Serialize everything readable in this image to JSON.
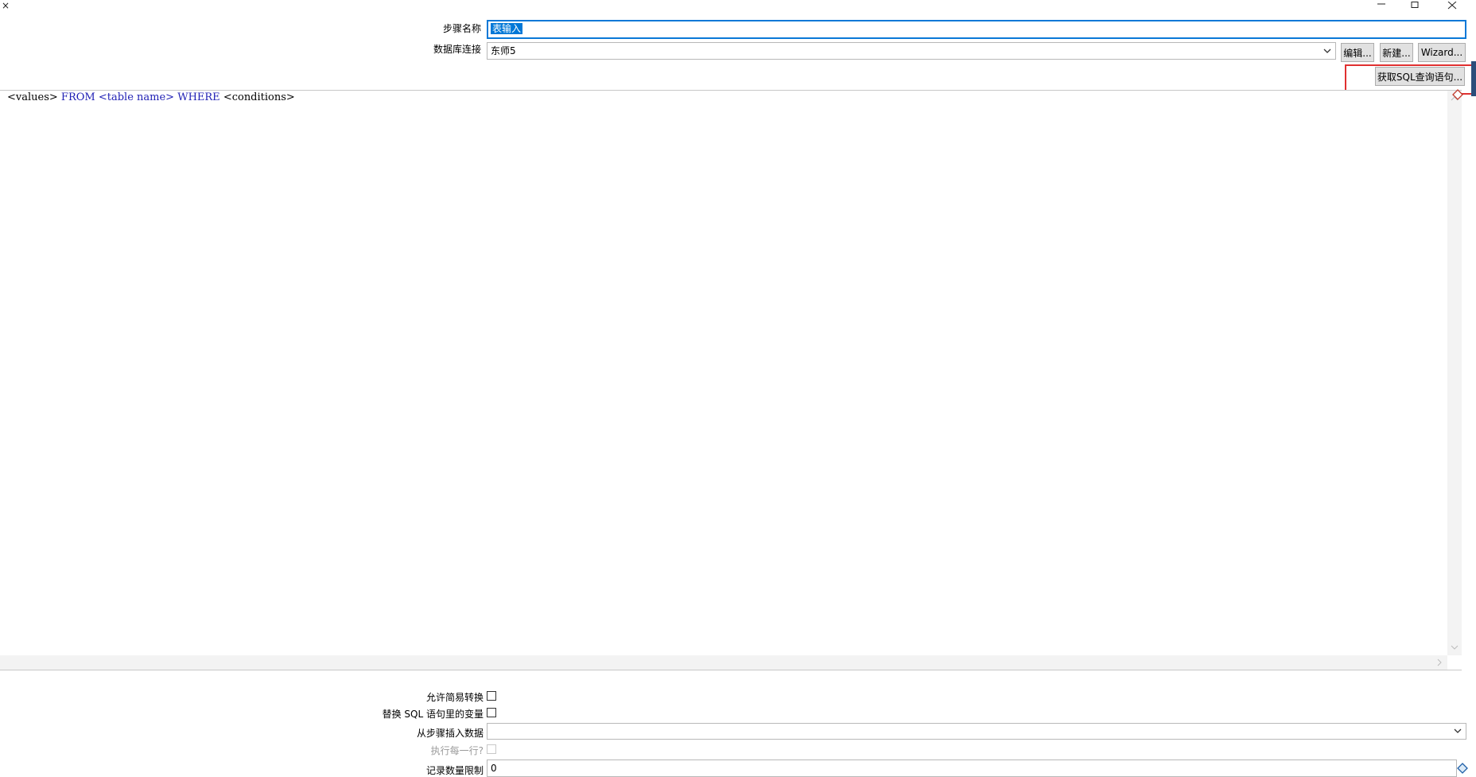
{
  "window": {
    "controls": {
      "close_left": "×",
      "minimize": "—",
      "maximize": "□",
      "close": "✕"
    }
  },
  "step_name": {
    "label": "步骤名称",
    "value": "表输入"
  },
  "db_connection": {
    "label": "数据库连接",
    "value": "东师5",
    "buttons": {
      "edit": "编辑...",
      "new": "新建...",
      "wizard": "Wizard..."
    }
  },
  "get_sql_button": "获取SQL查询语句...",
  "sql": {
    "values": "<values>",
    "from": "FROM",
    "table": "<table name>",
    "where": "WHERE",
    "conditions": "<conditions>"
  },
  "options": {
    "lazy_conversion": {
      "label": "允许简易转换",
      "checked": false
    },
    "replace_variables": {
      "label": "替换 SQL 语句里的变量",
      "checked": false
    },
    "insert_from_step": {
      "label": "从步骤插入数据",
      "value": ""
    },
    "execute_each_row": {
      "label": "执行每一行?",
      "checked": false,
      "enabled": false
    },
    "limit": {
      "label": "记录数量限制",
      "value": "0"
    }
  },
  "colors": {
    "highlight": "#e03030",
    "selection": "#0078d7",
    "keyword": "#1e1eb4"
  }
}
